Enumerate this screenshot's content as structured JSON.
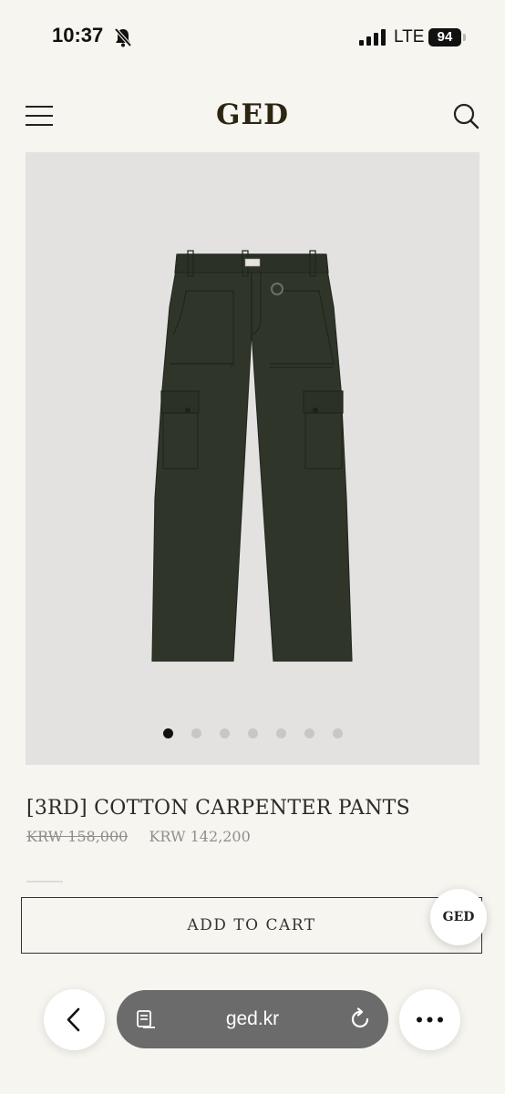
{
  "status_bar": {
    "time": "10:37",
    "network": "LTE",
    "battery": "94"
  },
  "header": {
    "brand": "GED"
  },
  "gallery": {
    "image_count": 7,
    "active_index": 0,
    "product_color": "#2f3629"
  },
  "product": {
    "title": "[3RD] COTTON CARPENTER PANTS",
    "original_price": "KRW 158,000",
    "sale_price": "KRW 142,200"
  },
  "actions": {
    "add_to_cart": "ADD TO CART",
    "chat_badge": "GED"
  },
  "browser": {
    "url": "ged.kr"
  },
  "icons": [
    "bell-muted-icon",
    "signal-icon",
    "menu-icon",
    "search-icon",
    "back-icon",
    "reader-icon",
    "reload-icon",
    "more-icon"
  ]
}
